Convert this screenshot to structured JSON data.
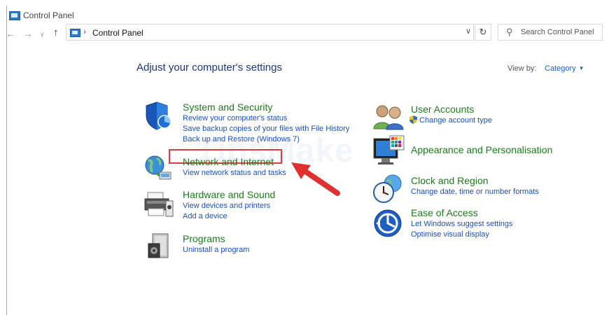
{
  "window": {
    "title": "Control Panel"
  },
  "nav": {
    "back_icon": "←",
    "forward_icon": "→",
    "recent_icon": "∨",
    "up_icon": "↑",
    "address_separator": "›",
    "address_path": "Control Panel",
    "dropdown_icon": "∨",
    "refresh_icon": "↻",
    "search_placeholder": "Search Control Panel",
    "search_glyph": "⚲"
  },
  "heading": "Adjust your computer's settings",
  "view_by": {
    "label": "View by:",
    "value": "Category",
    "arrow": "▼"
  },
  "left_categories": [
    {
      "title": "System and Security",
      "links": [
        "Review your computer's status",
        "Save backup copies of your files with File History",
        "Back up and Restore (Windows 7)"
      ],
      "icon": "shield-icon"
    },
    {
      "title": "Network and Internet",
      "links": [
        "View network status and tasks"
      ],
      "icon": "globe-network-icon"
    },
    {
      "title": "Hardware and Sound",
      "links": [
        "View devices and printers",
        "Add a device"
      ],
      "icon": "printer-icon"
    },
    {
      "title": "Programs",
      "links": [
        "Uninstall a program"
      ],
      "icon": "programs-box-icon"
    }
  ],
  "right_categories": [
    {
      "title": "User Accounts",
      "links": [
        "Change account type"
      ],
      "icon": "users-icon"
    },
    {
      "title": "Appearance and Personalisation",
      "links": [],
      "icon": "monitor-palette-icon"
    },
    {
      "title": "Clock and Region",
      "links": [
        "Change date, time or number formats"
      ],
      "icon": "clock-globe-icon"
    },
    {
      "title": "Ease of Access",
      "links": [
        "Let Windows suggest settings",
        "Optimise visual display"
      ],
      "icon": "ease-of-access-icon"
    }
  ],
  "watermark": "TipsMake",
  "colors": {
    "category_green": "#1b7b1b",
    "link_blue": "#1a4fc8",
    "heading_blue": "#1e3287",
    "highlight_red": "#e23b3b"
  }
}
